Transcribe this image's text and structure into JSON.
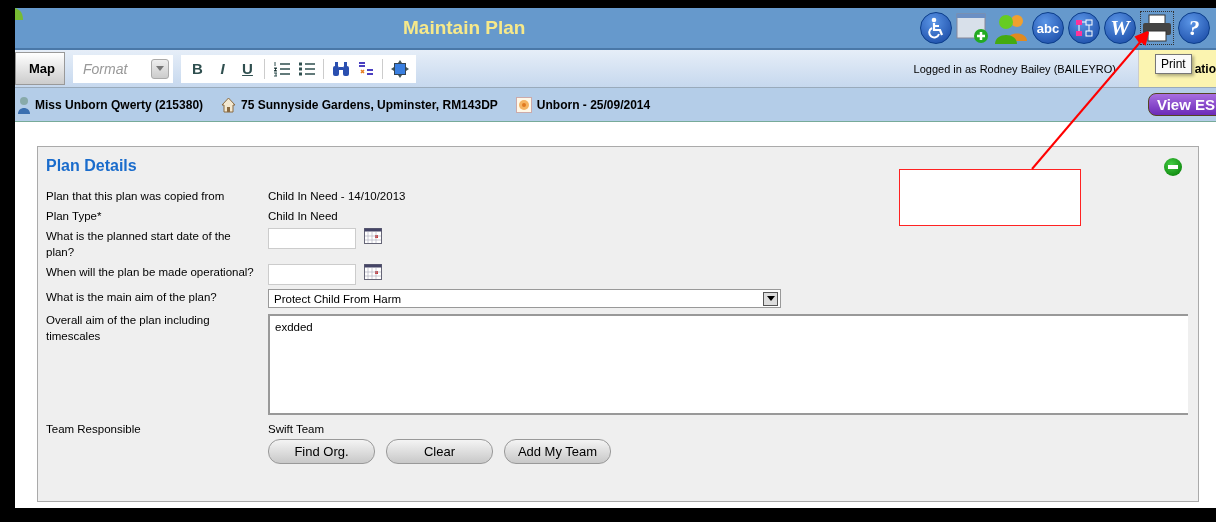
{
  "window": {
    "title": "Maintain Plan"
  },
  "title_icons": [
    {
      "kind": "accessibility"
    },
    {
      "kind": "new-window"
    },
    {
      "kind": "people"
    },
    {
      "kind": "text",
      "label": "abc"
    },
    {
      "kind": "diagram"
    },
    {
      "kind": "text",
      "label": "W"
    },
    {
      "kind": "print"
    },
    {
      "kind": "text",
      "label": "?"
    }
  ],
  "toolbar": {
    "map_button": "Map",
    "format": {
      "placeholder": "Format"
    },
    "buttons": [
      {
        "kind": "text",
        "label": "B"
      },
      {
        "kind": "text",
        "label": "I"
      },
      {
        "kind": "text",
        "label": "U"
      },
      {
        "kind": "separator"
      },
      {
        "kind": "numbered-list"
      },
      {
        "kind": "bullet-list"
      },
      {
        "kind": "separator"
      },
      {
        "kind": "find"
      },
      {
        "kind": "spellcheck"
      },
      {
        "kind": "separator"
      },
      {
        "kind": "maximize"
      }
    ],
    "logged_in": "Logged in as Rodney Bailey (BAILEYRO)",
    "yellow_tab": "atio"
  },
  "tooltip": "Print",
  "info_bar": {
    "items": [
      {
        "kind": "person",
        "text": "Miss Unborn Qwerty (215380)"
      },
      {
        "kind": "house",
        "text": "75 Sunnyside Gardens, Upminster, RM143DP"
      },
      {
        "kind": "baby",
        "text": "Unborn - 25/09/2014"
      }
    ],
    "view_button": "View ES"
  },
  "panel": {
    "title": "Plan Details",
    "expanded": true,
    "rows": [
      {
        "kind": "text",
        "label": "Plan that this plan was copied from",
        "value": "Child In Need - 14/10/2013"
      },
      {
        "kind": "text",
        "label": "Plan Type*",
        "value": "Child In Need"
      },
      {
        "kind": "date",
        "label": "What is the planned start date of the plan?"
      },
      {
        "kind": "date",
        "label": "When will the plan be made operational?"
      },
      {
        "kind": "select",
        "label": "What is the main aim of the plan?",
        "value": "Protect Child From Harm"
      },
      {
        "kind": "textarea",
        "label": "Overall aim of the plan including timescales",
        "value": "exdded"
      },
      {
        "kind": "team",
        "label": "Team Responsible",
        "value": "Swift Team",
        "buttons": [
          "Find Org.",
          "Clear",
          "Add My Team"
        ]
      }
    ]
  }
}
